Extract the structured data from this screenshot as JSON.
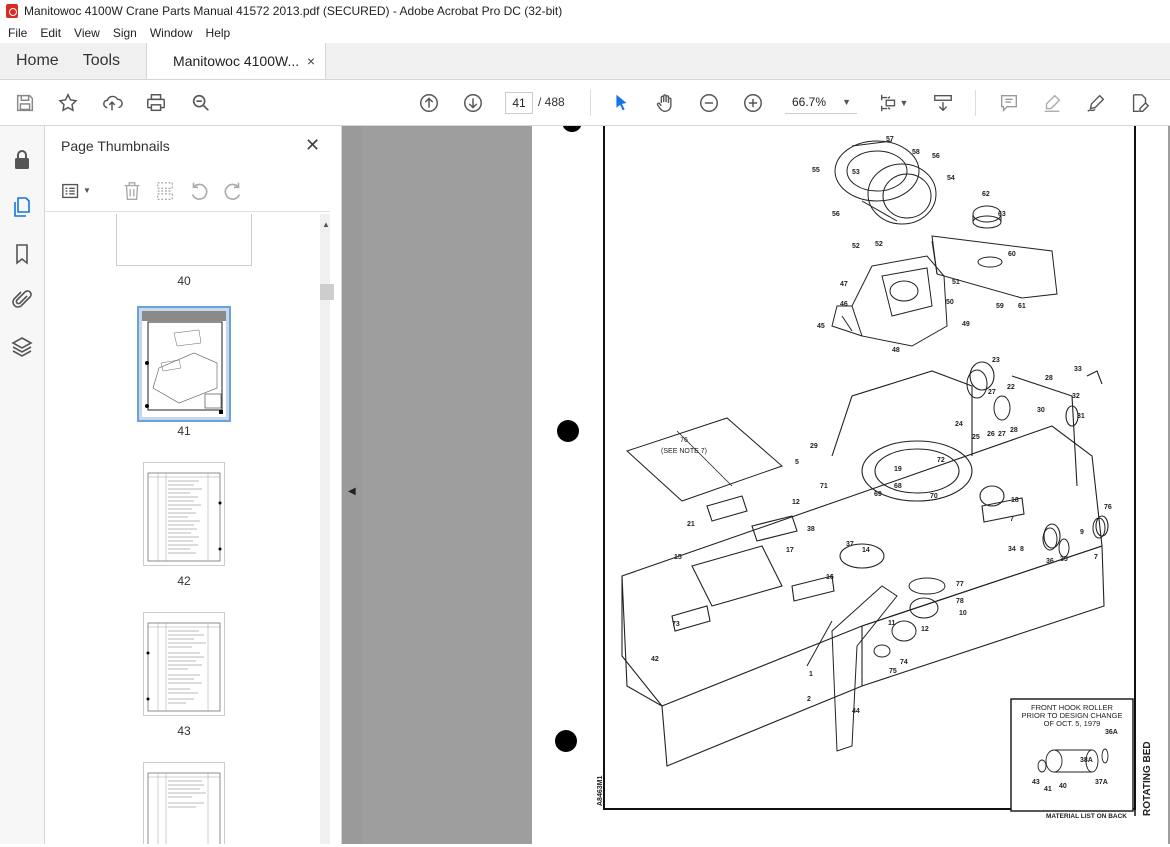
{
  "window": {
    "title": "Manitowoc 4100W Crane Parts Manual 41572 2013.pdf (SECURED) - Adobe Acrobat Pro DC (32-bit)"
  },
  "menu": [
    "File",
    "Edit",
    "View",
    "Sign",
    "Window",
    "Help"
  ],
  "tabs": {
    "home": "Home",
    "tools": "Tools",
    "document": "Manitowoc 4100W...",
    "close": "×"
  },
  "toolbar": {
    "current_page": "41",
    "total_pages": "/ 488",
    "zoom": "66.7%"
  },
  "thumbnails_panel": {
    "title": "Page Thumbnails",
    "close": "✕",
    "pages": [
      {
        "label": "40"
      },
      {
        "label": "41",
        "selected": true
      },
      {
        "label": "42"
      },
      {
        "label": "43"
      },
      {
        "label": ""
      }
    ]
  },
  "drawing": {
    "note_box_title": "76",
    "note_box_sub": "(SEE NOTE 7)",
    "inset_title_1": "FRONT HOOK ROLLER",
    "inset_title_2": "PRIOR TO DESIGN CHANGE",
    "inset_title_3": "OF OCT. 5, 1979",
    "side_title": "ROTATING BED",
    "footer": "MATERIAL LIST ON BACK",
    "drawing_number": "A8463M1",
    "callouts": [
      "55",
      "56",
      "57",
      "53",
      "58",
      "56",
      "54",
      "62",
      "63",
      "60",
      "52",
      "52",
      "51",
      "47",
      "50",
      "46",
      "45",
      "49",
      "48",
      "59",
      "61",
      "23",
      "33",
      "22",
      "28",
      "32",
      "30",
      "31",
      "27",
      "24",
      "25",
      "26",
      "27",
      "28",
      "29",
      "72",
      "5",
      "71",
      "19",
      "68",
      "69",
      "70",
      "12",
      "18",
      "76",
      "7",
      "34",
      "8",
      "9",
      "7",
      "36",
      "35",
      "38",
      "37",
      "17",
      "14",
      "16",
      "21",
      "15",
      "77",
      "78",
      "10",
      "11",
      "12",
      "74",
      "75",
      "73",
      "42",
      "1",
      "2",
      "44",
      "43",
      "41",
      "40",
      "38A",
      "37A",
      "36A",
      "35",
      "34"
    ]
  }
}
